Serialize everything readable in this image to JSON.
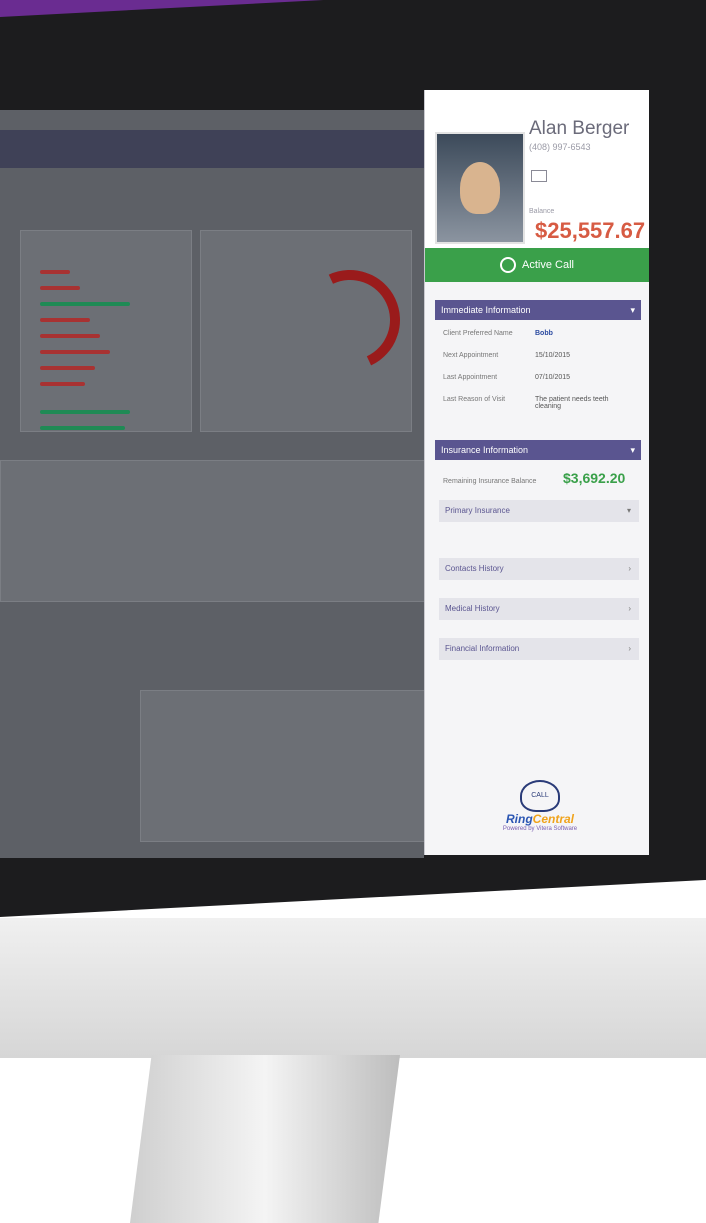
{
  "profile": {
    "name": "Alan Berger",
    "phone": "(408) 997-6543",
    "balance_label": "Balance",
    "balance": "$25,557.67"
  },
  "call": {
    "label": "Active Call"
  },
  "immediate": {
    "title": "Immediate Information",
    "rows": [
      {
        "label": "Client Preferred Name",
        "value": "Bobb"
      },
      {
        "label": "Next Appointment",
        "value": "15/10/2015"
      },
      {
        "label": "Last Appointment",
        "value": "07/10/2015"
      },
      {
        "label": "Last Reason of Visit",
        "value": "The patient needs teeth cleaning"
      }
    ]
  },
  "insurance": {
    "title": "Insurance Information",
    "balance_label": "Remaining Insurance Balance",
    "balance": "$3,692.20",
    "primary": "Primary Insurance"
  },
  "sections": [
    "Contacts History",
    "Medical History",
    "Financial Information"
  ],
  "logo": {
    "line1": "Ring",
    "line2": "Central",
    "powered": "Powered by Vitera Software",
    "call": "CALL"
  },
  "colors": {
    "banner": "#6a2c91",
    "header": "#5a5590",
    "call": "#3aa04a",
    "balance": "#d75b43",
    "insurance_balance": "#3aa04a"
  }
}
